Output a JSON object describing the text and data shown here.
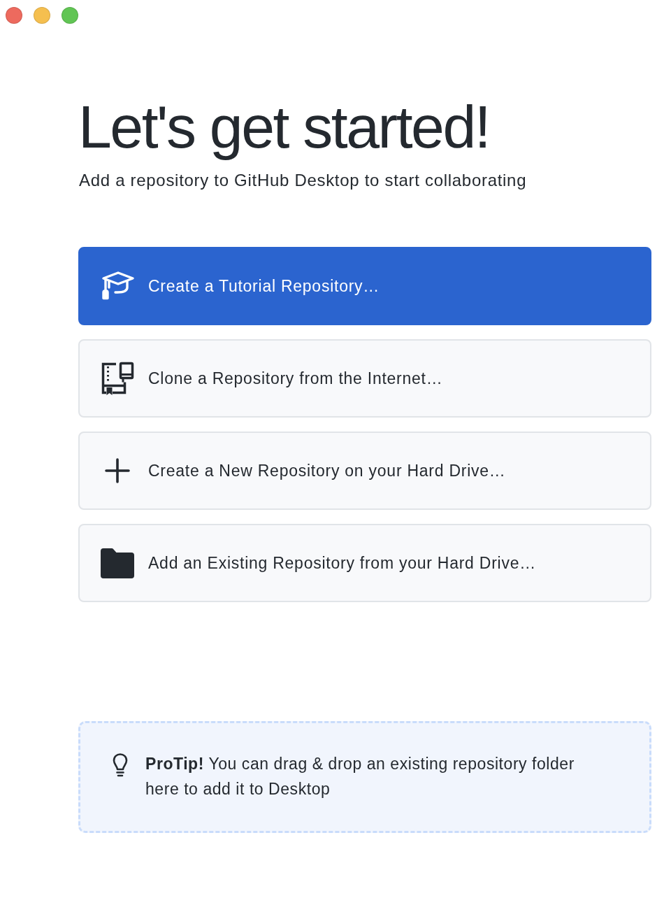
{
  "window": {
    "controls": [
      {
        "color": "#ed6a5e"
      },
      {
        "color": "#f5bf4f"
      },
      {
        "color": "#61c554"
      }
    ]
  },
  "heading": "Let's get started!",
  "subtitle": "Add a repository to GitHub Desktop to start collaborating",
  "actions": [
    {
      "kind": "tutorial",
      "label": "Create a Tutorial Repository…",
      "primary": true
    },
    {
      "kind": "clone",
      "label": "Clone a Repository from the Internet…",
      "primary": false
    },
    {
      "kind": "create",
      "label": "Create a New Repository on your Hard Drive…",
      "primary": false
    },
    {
      "kind": "add",
      "label": "Add an Existing Repository from your Hard Drive…",
      "primary": false
    }
  ],
  "tip": {
    "text": "**ProTip!** You can drag & drop an existing repository folder here to add it to Desktop"
  }
}
